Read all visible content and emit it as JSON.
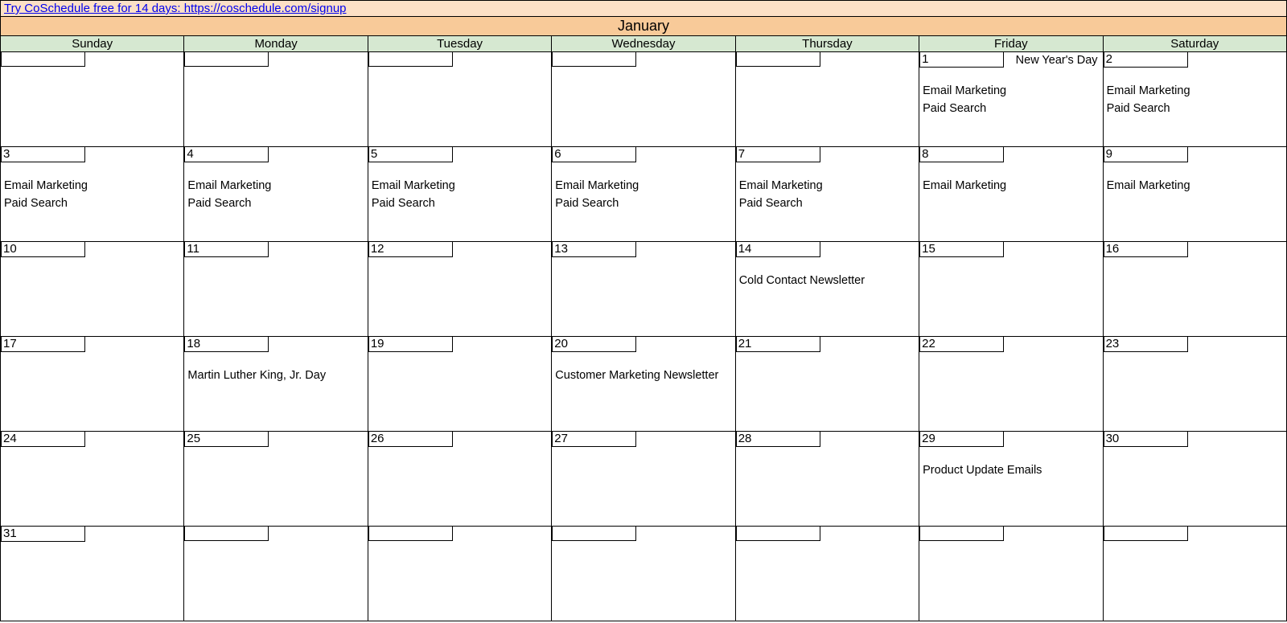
{
  "banner": {
    "link_text": "Try CoSchedule free for 14 days: https://coschedule.com/signup"
  },
  "month": "January",
  "day_headers": [
    "Sunday",
    "Monday",
    "Tuesday",
    "Wednesday",
    "Thursday",
    "Friday",
    "Saturday"
  ],
  "weeks": [
    [
      {
        "date": "",
        "holiday": "",
        "events": []
      },
      {
        "date": "",
        "holiday": "",
        "events": []
      },
      {
        "date": "",
        "holiday": "",
        "events": []
      },
      {
        "date": "",
        "holiday": "",
        "events": []
      },
      {
        "date": "",
        "holiday": "",
        "events": []
      },
      {
        "date": "1",
        "holiday": "New Year's Day",
        "events": [
          "Email Marketing",
          "Paid Search"
        ]
      },
      {
        "date": "2",
        "holiday": "",
        "events": [
          "Email Marketing",
          "Paid Search"
        ]
      }
    ],
    [
      {
        "date": "3",
        "holiday": "",
        "events": [
          "Email Marketing",
          "Paid Search"
        ]
      },
      {
        "date": "4",
        "holiday": "",
        "events": [
          "Email Marketing",
          "Paid Search"
        ]
      },
      {
        "date": "5",
        "holiday": "",
        "events": [
          "Email Marketing",
          "Paid Search"
        ]
      },
      {
        "date": "6",
        "holiday": "",
        "events": [
          "Email Marketing",
          "Paid Search"
        ]
      },
      {
        "date": "7",
        "holiday": "",
        "events": [
          "Email Marketing",
          "Paid Search"
        ]
      },
      {
        "date": "8",
        "holiday": "",
        "events": [
          "Email Marketing"
        ]
      },
      {
        "date": "9",
        "holiday": "",
        "events": [
          "Email Marketing"
        ]
      }
    ],
    [
      {
        "date": "10",
        "holiday": "",
        "events": []
      },
      {
        "date": "11",
        "holiday": "",
        "events": []
      },
      {
        "date": "12",
        "holiday": "",
        "events": []
      },
      {
        "date": "13",
        "holiday": "",
        "events": []
      },
      {
        "date": "14",
        "holiday": "",
        "events": [
          "Cold Contact Newsletter"
        ]
      },
      {
        "date": "15",
        "holiday": "",
        "events": []
      },
      {
        "date": "16",
        "holiday": "",
        "events": []
      }
    ],
    [
      {
        "date": "17",
        "holiday": "",
        "events": []
      },
      {
        "date": "18",
        "holiday": "",
        "events": [
          "Martin Luther King, Jr. Day"
        ]
      },
      {
        "date": "19",
        "holiday": "",
        "events": []
      },
      {
        "date": "20",
        "holiday": "",
        "events": [
          "Customer Marketing Newsletter"
        ]
      },
      {
        "date": "21",
        "holiday": "",
        "events": []
      },
      {
        "date": "22",
        "holiday": "",
        "events": []
      },
      {
        "date": "23",
        "holiday": "",
        "events": []
      }
    ],
    [
      {
        "date": "24",
        "holiday": "",
        "events": []
      },
      {
        "date": "25",
        "holiday": "",
        "events": []
      },
      {
        "date": "26",
        "holiday": "",
        "events": []
      },
      {
        "date": "27",
        "holiday": "",
        "events": []
      },
      {
        "date": "28",
        "holiday": "",
        "events": []
      },
      {
        "date": "29",
        "holiday": "",
        "events": [
          "Product Update Emails"
        ]
      },
      {
        "date": "30",
        "holiday": "",
        "events": []
      }
    ],
    [
      {
        "date": "31",
        "holiday": "",
        "events": []
      },
      {
        "date": "",
        "holiday": "",
        "events": []
      },
      {
        "date": "",
        "holiday": "",
        "events": []
      },
      {
        "date": "",
        "holiday": "",
        "events": []
      },
      {
        "date": "",
        "holiday": "",
        "events": []
      },
      {
        "date": "",
        "holiday": "",
        "events": []
      },
      {
        "date": "",
        "holiday": "",
        "events": []
      }
    ]
  ]
}
